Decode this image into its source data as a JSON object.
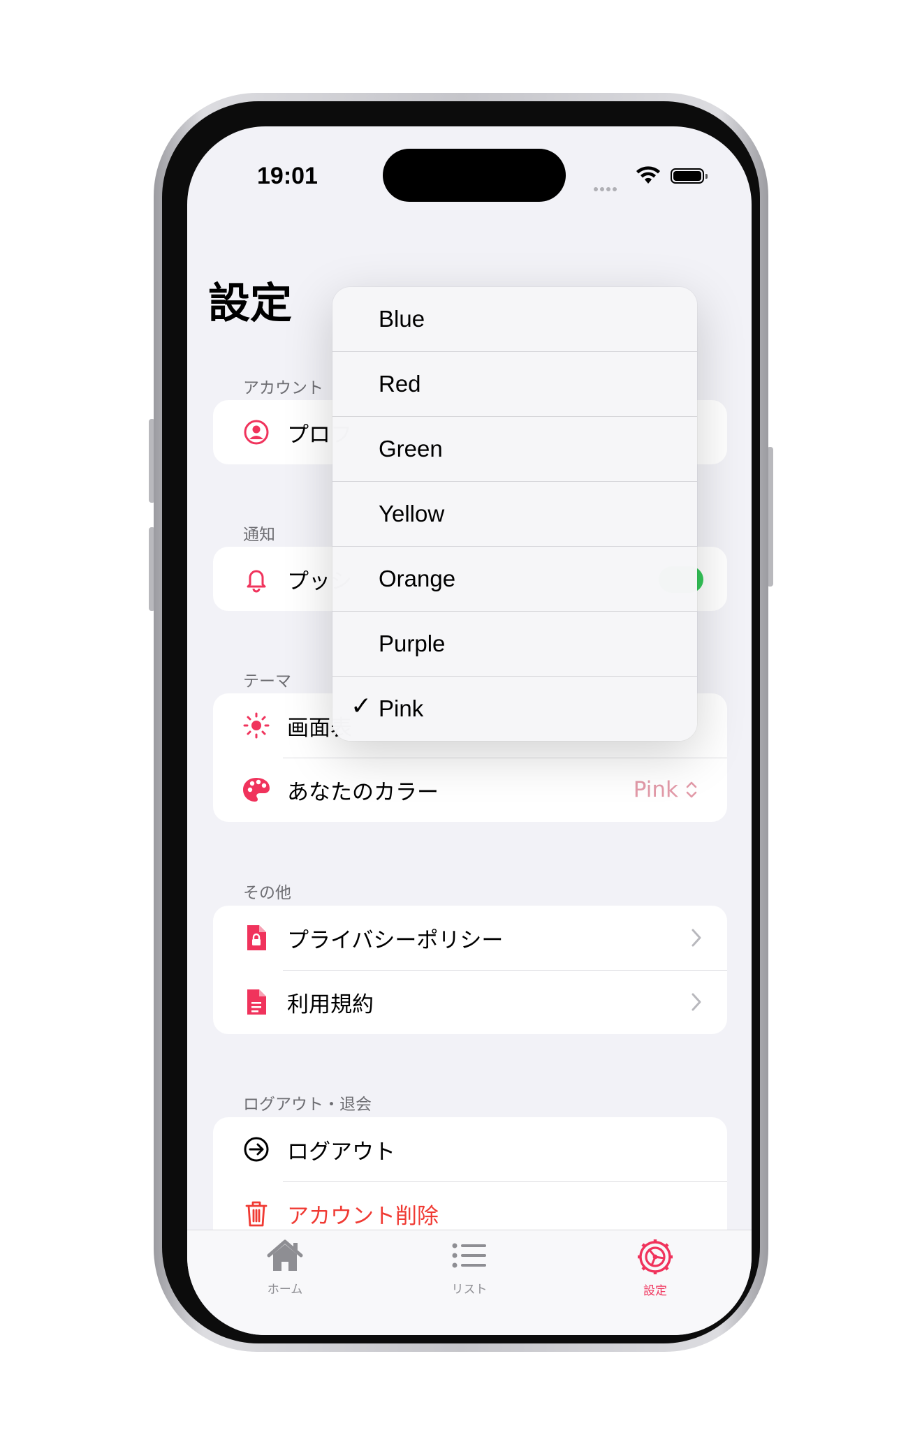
{
  "status_bar": {
    "time": "19:01"
  },
  "page_title": "設定",
  "sections": {
    "account": {
      "header": "アカウント",
      "profile_label": "プロフ"
    },
    "notifications": {
      "header": "通知",
      "push_label": "プッシ"
    },
    "theme": {
      "header": "テーマ",
      "screen_label": "画面表",
      "color_label": "あなたのカラー",
      "color_value": "Pink"
    },
    "other": {
      "header": "その他",
      "privacy_label": "プライバシーポリシー",
      "terms_label": "利用規約"
    },
    "logout": {
      "header": "ログアウト・退会",
      "logout_label": "ログアウト",
      "delete_label": "アカウント削除"
    }
  },
  "color_menu": {
    "items": [
      "Blue",
      "Red",
      "Green",
      "Yellow",
      "Orange",
      "Purple",
      "Pink"
    ],
    "selected": "Pink"
  },
  "tabbar": {
    "home": "ホーム",
    "list": "リスト",
    "settings": "設定",
    "active": "settings"
  },
  "colors": {
    "accent": "#f0335c",
    "danger": "#f03a33",
    "toggle_on": "#34c759",
    "background": "#f2f2f7"
  }
}
